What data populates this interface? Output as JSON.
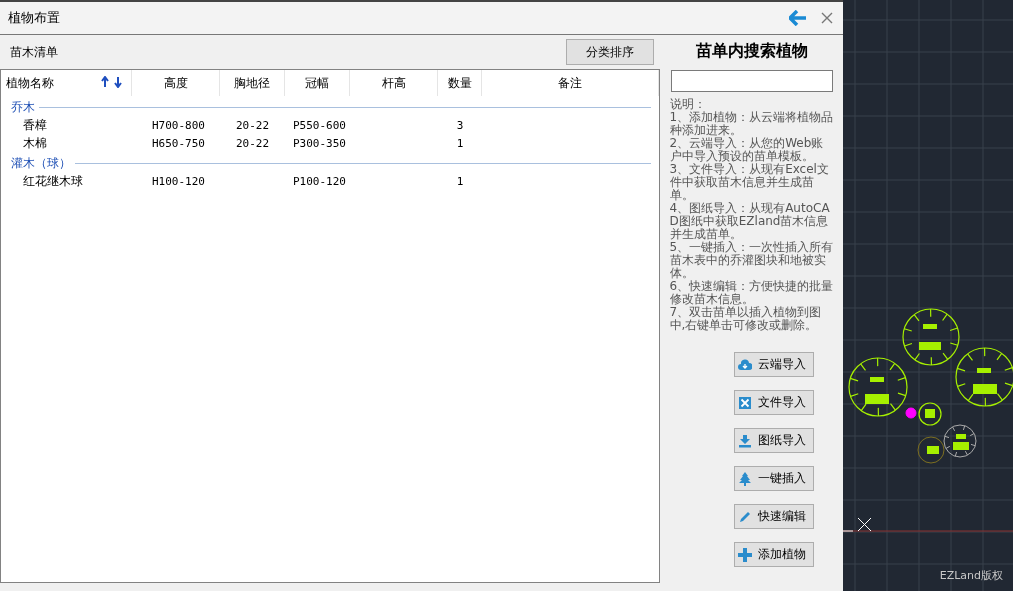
{
  "window": {
    "title": "植物布置"
  },
  "list_label": "苗木清单",
  "sort_button": "分类排序",
  "columns": [
    "植物名称",
    "高度",
    "胸地径",
    "冠幅",
    "杆高",
    "数量",
    "备注"
  ],
  "groups": [
    {
      "name": "乔木",
      "rows": [
        [
          "香樟",
          "H700-800",
          "20-22",
          "P550-600",
          "",
          "3",
          ""
        ],
        [
          "木棉",
          "H650-750",
          "20-22",
          "P300-350",
          "",
          "1",
          ""
        ]
      ]
    },
    {
      "name": "灌木（球）",
      "rows": [
        [
          "红花继木球",
          "H100-120",
          "",
          "P100-120",
          "",
          "1",
          ""
        ]
      ]
    }
  ],
  "search_title": "苗单内搜索植物",
  "help_title": "说明：",
  "help_items": [
    "1、添加植物：从云端将植物品种添加进来。",
    "2、云端导入：从您的Web账户中导入预设的苗单模板。",
    "3、文件导入：从现有Excel文件中获取苗木信息并生成苗单。",
    "4、图纸导入：从现有AutoCAD图纸中获取EZland苗木信息并生成苗单。",
    "5、一键插入：一次性插入所有苗木表中的乔灌图块和地被实体。",
    "6、快速编辑：方便快捷的批量修改苗木信息。",
    "7、双击苗单以插入植物到图中,右键单击可修改或删除。"
  ],
  "buttons": [
    {
      "label": "云端导入",
      "kind": "cloud"
    },
    {
      "label": "文件导入",
      "kind": "excel"
    },
    {
      "label": "图纸导入",
      "kind": "download"
    },
    {
      "label": "一键插入",
      "kind": "tree"
    },
    {
      "label": "快速编辑",
      "kind": "pencil"
    },
    {
      "label": "添加植物",
      "kind": "plus"
    }
  ],
  "canvas": {
    "copyright": "EZLand版权"
  }
}
